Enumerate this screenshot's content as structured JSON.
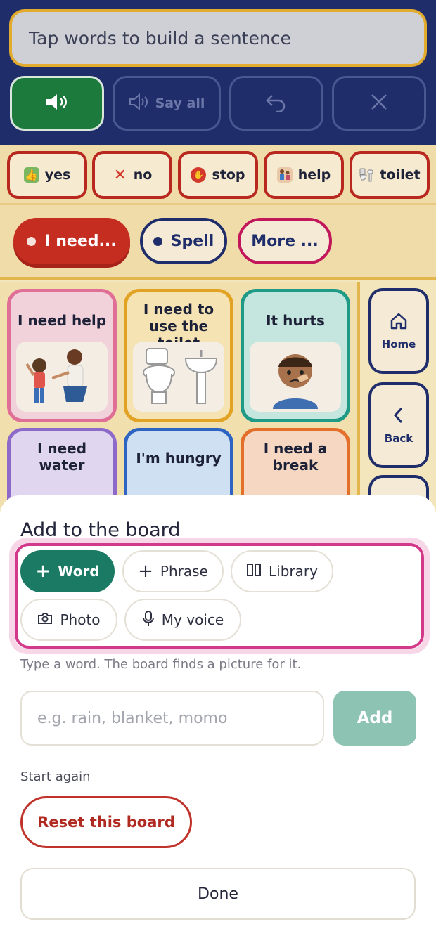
{
  "sentence": {
    "placeholder": "Tap words to build a sentence"
  },
  "controls": {
    "say_all": "Say all"
  },
  "quick_words": [
    {
      "label": "yes",
      "icon": "thumbs-up-icon"
    },
    {
      "label": "no",
      "icon": "x-mark-icon"
    },
    {
      "label": "stop",
      "icon": "stop-hand-icon"
    },
    {
      "label": "help",
      "icon": "help-person-icon"
    },
    {
      "label": "toilet",
      "icon": "toilet-icon"
    }
  ],
  "categories": [
    {
      "label": "I need...",
      "selected": true
    },
    {
      "label": "Spell"
    },
    {
      "label": "More ..."
    }
  ],
  "tiles": [
    {
      "label": "I need help"
    },
    {
      "label": "I need to use the toilet"
    },
    {
      "label": "It hurts"
    },
    {
      "label": "I need water"
    },
    {
      "label": "I'm hungry"
    },
    {
      "label": "I need a break"
    }
  ],
  "side_nav": {
    "home": "Home",
    "back": "Back"
  },
  "sheet": {
    "title": "Add to the board",
    "options": [
      {
        "label": "Word",
        "icon": "plus-icon",
        "selected": true
      },
      {
        "label": "Phrase",
        "icon": "plus-icon"
      },
      {
        "label": "Library",
        "icon": "library-icon"
      },
      {
        "label": "Photo",
        "icon": "camera-icon"
      },
      {
        "label": "My voice",
        "icon": "microphone-icon"
      }
    ],
    "hint": "Type a word. The board finds a picture for it.",
    "input_placeholder": "e.g. rain, blanket, momo",
    "add_label": "Add",
    "start_again": "Start again",
    "reset_label": "Reset this board",
    "done_label": "Done"
  }
}
